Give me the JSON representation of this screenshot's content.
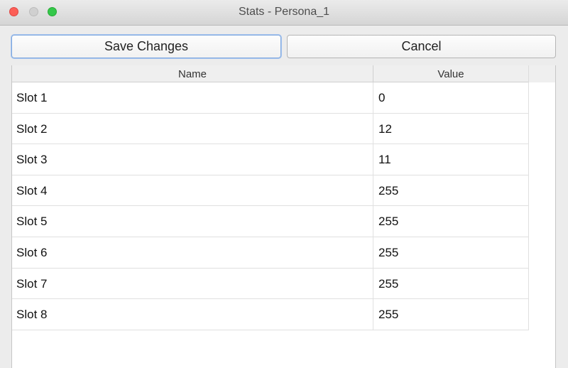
{
  "window": {
    "title": "Stats - Persona_1"
  },
  "toolbar": {
    "save_label": "Save Changes",
    "cancel_label": "Cancel"
  },
  "table": {
    "columns": [
      "Name",
      "Value"
    ],
    "rows": [
      {
        "name": "Slot 1",
        "value": "0"
      },
      {
        "name": "Slot 2",
        "value": "12"
      },
      {
        "name": "Slot 3",
        "value": "11"
      },
      {
        "name": "Slot 4",
        "value": "255"
      },
      {
        "name": "Slot 5",
        "value": "255"
      },
      {
        "name": "Slot 6",
        "value": "255"
      },
      {
        "name": "Slot 7",
        "value": "255"
      },
      {
        "name": "Slot 8",
        "value": "255"
      }
    ]
  }
}
